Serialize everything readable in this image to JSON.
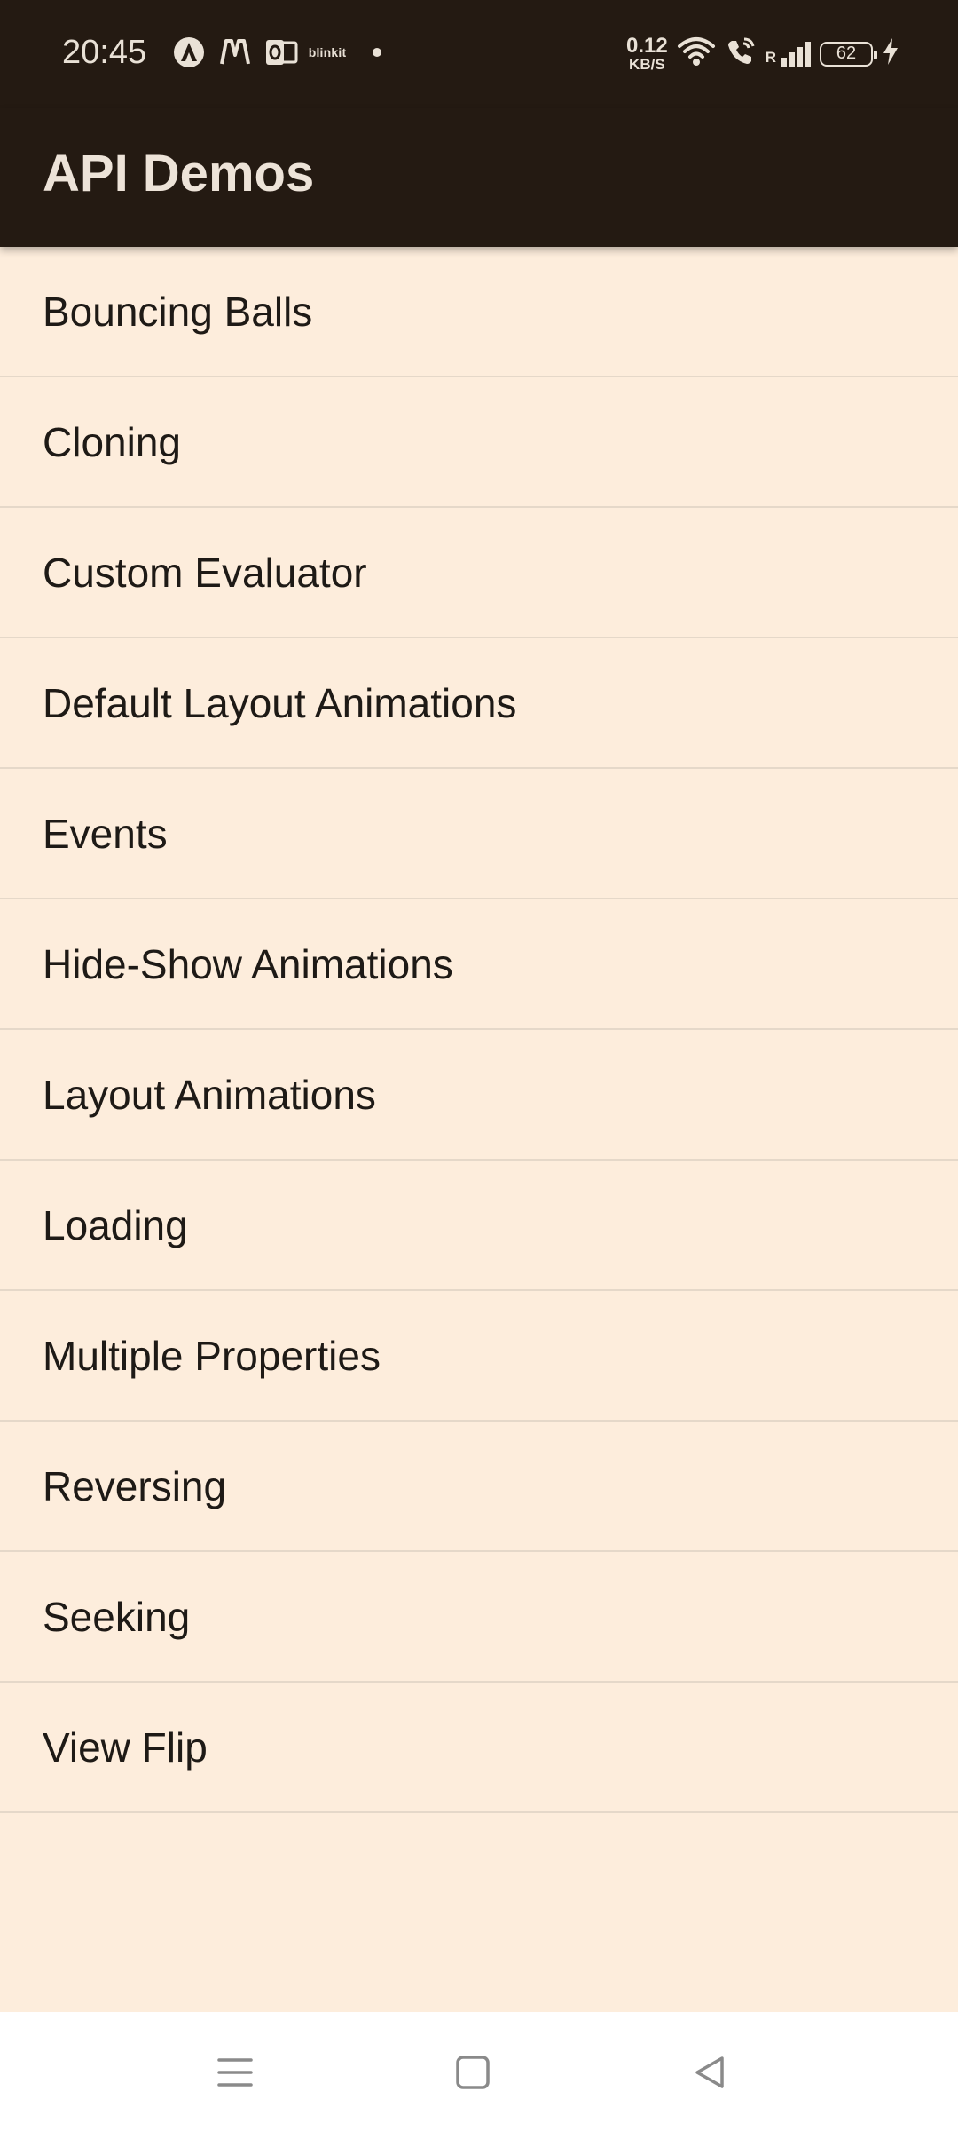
{
  "status_bar": {
    "time": "20:45",
    "app_icons": [
      "a-logo-icon",
      "myntra-icon",
      "outlook-icon",
      "blinkit-icon"
    ],
    "blinkit_text": "blinkit",
    "net_speed_value": "0.12",
    "net_speed_unit": "KB/S",
    "roaming_label": "R",
    "battery_level": "62",
    "charging": true
  },
  "app_bar": {
    "title": "API Demos",
    "background_color": "#241A12"
  },
  "list": {
    "items": [
      "Bouncing Balls",
      "Cloning",
      "Custom Evaluator",
      "Default Layout Animations",
      "Events",
      "Hide-Show Animations",
      "Layout Animations",
      "Loading",
      "Multiple Properties",
      "Reversing",
      "Seeking",
      "View Flip"
    ],
    "background_color": "#FDEDDC"
  },
  "nav_bar": {
    "buttons": [
      "menu-icon",
      "home-icon",
      "back-icon"
    ]
  }
}
